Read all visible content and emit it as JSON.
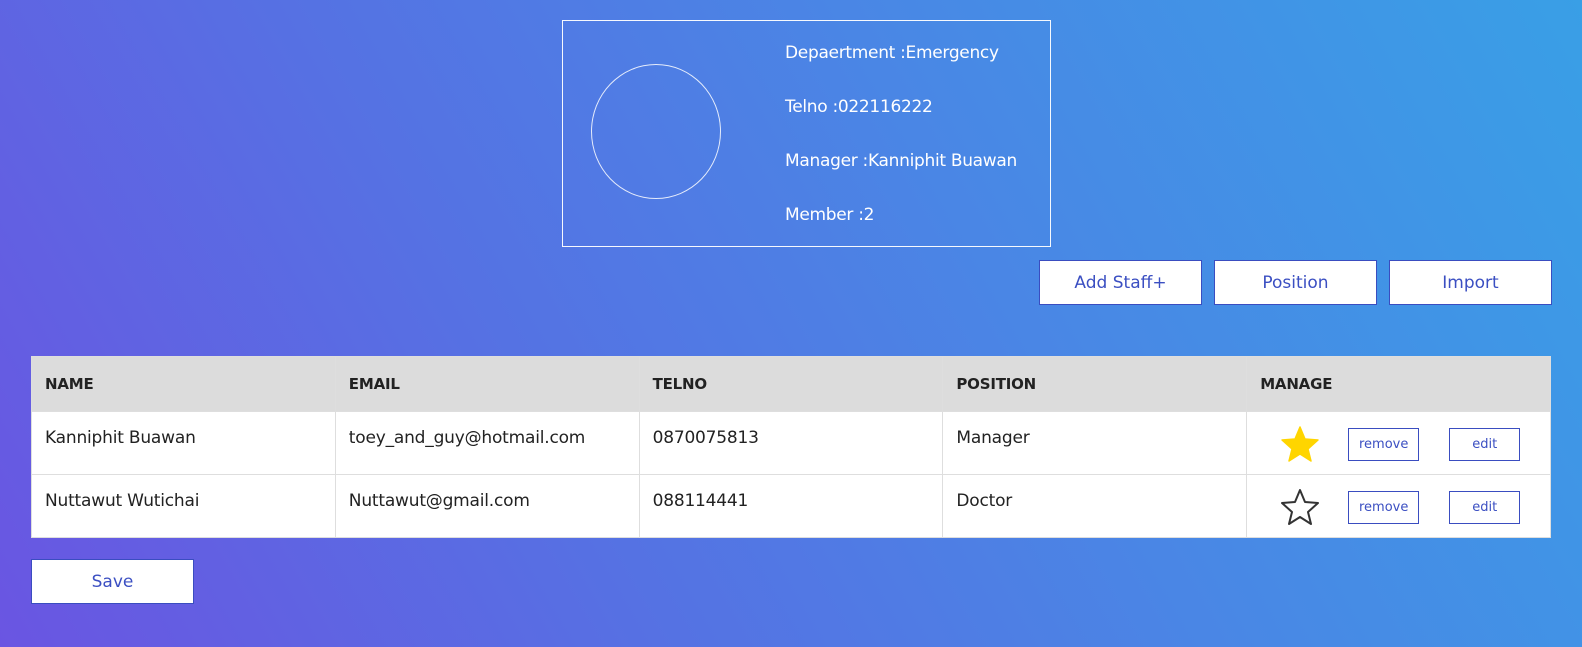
{
  "department": {
    "department_line": "Depaertment :Emergency",
    "telno_line": "Telno :022116222",
    "manager_line": "Manager :Kanniphit Buawan",
    "member_line": "Member :2"
  },
  "actions": {
    "add_staff": "Add Staff+",
    "position": "Position",
    "import": "Import"
  },
  "table": {
    "headers": [
      "NAME",
      "EMAIL",
      "TELNO",
      "POSITION",
      "MANAGE"
    ],
    "rows": [
      {
        "name": "Kanniphit Buawan",
        "email": "toey_and_guy@hotmail.com",
        "telno": "0870075813",
        "position": "Manager",
        "starred": true,
        "remove": "remove",
        "edit": "edit"
      },
      {
        "name": "Nuttawut Wutichai",
        "email": "Nuttawut@gmail.com",
        "telno": "088114441",
        "position": "Doctor",
        "starred": false,
        "remove": "remove",
        "edit": "edit"
      }
    ]
  },
  "save_label": "Save",
  "icons": {
    "star_filled": "star-filled-icon",
    "star_outline": "star-outline-icon"
  },
  "colors": {
    "accent": "#3a4dc0",
    "star": "#ffd500",
    "header_bg": "#dcdcdc"
  }
}
